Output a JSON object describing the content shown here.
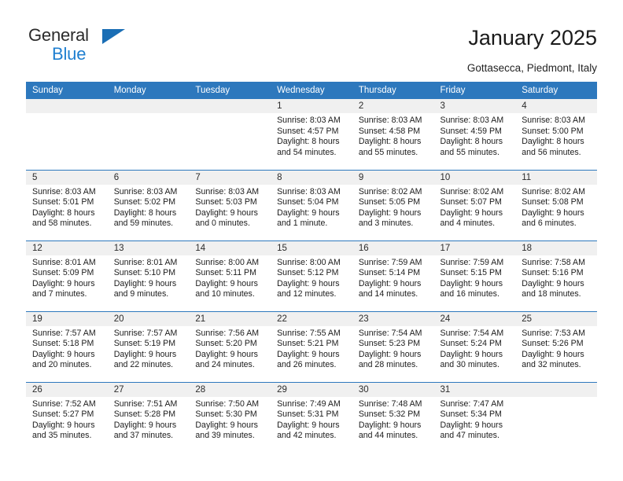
{
  "brand": {
    "line1": "General",
    "line2": "Blue",
    "accent_color": "#1f7fd0",
    "triangle_color": "#1a6eb5"
  },
  "header": {
    "title": "January 2025",
    "subtitle": "Gottasecca, Piedmont, Italy"
  },
  "theme": {
    "header_bg": "#2d78bd",
    "header_text": "#ffffff",
    "daynum_bg": "#f0f0f0",
    "cell_bg": "#ffffff",
    "text": "#1c1c1c"
  },
  "weekdays": [
    "Sunday",
    "Monday",
    "Tuesday",
    "Wednesday",
    "Thursday",
    "Friday",
    "Saturday"
  ],
  "labels": {
    "sunrise": "Sunrise:",
    "sunset": "Sunset:",
    "daylight": "Daylight:"
  },
  "weeks": [
    [
      {
        "day": ""
      },
      {
        "day": ""
      },
      {
        "day": ""
      },
      {
        "day": "1",
        "sunrise": "Sunrise: 8:03 AM",
        "sunset": "Sunset: 4:57 PM",
        "daylight1": "Daylight: 8 hours",
        "daylight2": "and 54 minutes."
      },
      {
        "day": "2",
        "sunrise": "Sunrise: 8:03 AM",
        "sunset": "Sunset: 4:58 PM",
        "daylight1": "Daylight: 8 hours",
        "daylight2": "and 55 minutes."
      },
      {
        "day": "3",
        "sunrise": "Sunrise: 8:03 AM",
        "sunset": "Sunset: 4:59 PM",
        "daylight1": "Daylight: 8 hours",
        "daylight2": "and 55 minutes."
      },
      {
        "day": "4",
        "sunrise": "Sunrise: 8:03 AM",
        "sunset": "Sunset: 5:00 PM",
        "daylight1": "Daylight: 8 hours",
        "daylight2": "and 56 minutes."
      }
    ],
    [
      {
        "day": "5",
        "sunrise": "Sunrise: 8:03 AM",
        "sunset": "Sunset: 5:01 PM",
        "daylight1": "Daylight: 8 hours",
        "daylight2": "and 58 minutes."
      },
      {
        "day": "6",
        "sunrise": "Sunrise: 8:03 AM",
        "sunset": "Sunset: 5:02 PM",
        "daylight1": "Daylight: 8 hours",
        "daylight2": "and 59 minutes."
      },
      {
        "day": "7",
        "sunrise": "Sunrise: 8:03 AM",
        "sunset": "Sunset: 5:03 PM",
        "daylight1": "Daylight: 9 hours",
        "daylight2": "and 0 minutes."
      },
      {
        "day": "8",
        "sunrise": "Sunrise: 8:03 AM",
        "sunset": "Sunset: 5:04 PM",
        "daylight1": "Daylight: 9 hours",
        "daylight2": "and 1 minute."
      },
      {
        "day": "9",
        "sunrise": "Sunrise: 8:02 AM",
        "sunset": "Sunset: 5:05 PM",
        "daylight1": "Daylight: 9 hours",
        "daylight2": "and 3 minutes."
      },
      {
        "day": "10",
        "sunrise": "Sunrise: 8:02 AM",
        "sunset": "Sunset: 5:07 PM",
        "daylight1": "Daylight: 9 hours",
        "daylight2": "and 4 minutes."
      },
      {
        "day": "11",
        "sunrise": "Sunrise: 8:02 AM",
        "sunset": "Sunset: 5:08 PM",
        "daylight1": "Daylight: 9 hours",
        "daylight2": "and 6 minutes."
      }
    ],
    [
      {
        "day": "12",
        "sunrise": "Sunrise: 8:01 AM",
        "sunset": "Sunset: 5:09 PM",
        "daylight1": "Daylight: 9 hours",
        "daylight2": "and 7 minutes."
      },
      {
        "day": "13",
        "sunrise": "Sunrise: 8:01 AM",
        "sunset": "Sunset: 5:10 PM",
        "daylight1": "Daylight: 9 hours",
        "daylight2": "and 9 minutes."
      },
      {
        "day": "14",
        "sunrise": "Sunrise: 8:00 AM",
        "sunset": "Sunset: 5:11 PM",
        "daylight1": "Daylight: 9 hours",
        "daylight2": "and 10 minutes."
      },
      {
        "day": "15",
        "sunrise": "Sunrise: 8:00 AM",
        "sunset": "Sunset: 5:12 PM",
        "daylight1": "Daylight: 9 hours",
        "daylight2": "and 12 minutes."
      },
      {
        "day": "16",
        "sunrise": "Sunrise: 7:59 AM",
        "sunset": "Sunset: 5:14 PM",
        "daylight1": "Daylight: 9 hours",
        "daylight2": "and 14 minutes."
      },
      {
        "day": "17",
        "sunrise": "Sunrise: 7:59 AM",
        "sunset": "Sunset: 5:15 PM",
        "daylight1": "Daylight: 9 hours",
        "daylight2": "and 16 minutes."
      },
      {
        "day": "18",
        "sunrise": "Sunrise: 7:58 AM",
        "sunset": "Sunset: 5:16 PM",
        "daylight1": "Daylight: 9 hours",
        "daylight2": "and 18 minutes."
      }
    ],
    [
      {
        "day": "19",
        "sunrise": "Sunrise: 7:57 AM",
        "sunset": "Sunset: 5:18 PM",
        "daylight1": "Daylight: 9 hours",
        "daylight2": "and 20 minutes."
      },
      {
        "day": "20",
        "sunrise": "Sunrise: 7:57 AM",
        "sunset": "Sunset: 5:19 PM",
        "daylight1": "Daylight: 9 hours",
        "daylight2": "and 22 minutes."
      },
      {
        "day": "21",
        "sunrise": "Sunrise: 7:56 AM",
        "sunset": "Sunset: 5:20 PM",
        "daylight1": "Daylight: 9 hours",
        "daylight2": "and 24 minutes."
      },
      {
        "day": "22",
        "sunrise": "Sunrise: 7:55 AM",
        "sunset": "Sunset: 5:21 PM",
        "daylight1": "Daylight: 9 hours",
        "daylight2": "and 26 minutes."
      },
      {
        "day": "23",
        "sunrise": "Sunrise: 7:54 AM",
        "sunset": "Sunset: 5:23 PM",
        "daylight1": "Daylight: 9 hours",
        "daylight2": "and 28 minutes."
      },
      {
        "day": "24",
        "sunrise": "Sunrise: 7:54 AM",
        "sunset": "Sunset: 5:24 PM",
        "daylight1": "Daylight: 9 hours",
        "daylight2": "and 30 minutes."
      },
      {
        "day": "25",
        "sunrise": "Sunrise: 7:53 AM",
        "sunset": "Sunset: 5:26 PM",
        "daylight1": "Daylight: 9 hours",
        "daylight2": "and 32 minutes."
      }
    ],
    [
      {
        "day": "26",
        "sunrise": "Sunrise: 7:52 AM",
        "sunset": "Sunset: 5:27 PM",
        "daylight1": "Daylight: 9 hours",
        "daylight2": "and 35 minutes."
      },
      {
        "day": "27",
        "sunrise": "Sunrise: 7:51 AM",
        "sunset": "Sunset: 5:28 PM",
        "daylight1": "Daylight: 9 hours",
        "daylight2": "and 37 minutes."
      },
      {
        "day": "28",
        "sunrise": "Sunrise: 7:50 AM",
        "sunset": "Sunset: 5:30 PM",
        "daylight1": "Daylight: 9 hours",
        "daylight2": "and 39 minutes."
      },
      {
        "day": "29",
        "sunrise": "Sunrise: 7:49 AM",
        "sunset": "Sunset: 5:31 PM",
        "daylight1": "Daylight: 9 hours",
        "daylight2": "and 42 minutes."
      },
      {
        "day": "30",
        "sunrise": "Sunrise: 7:48 AM",
        "sunset": "Sunset: 5:32 PM",
        "daylight1": "Daylight: 9 hours",
        "daylight2": "and 44 minutes."
      },
      {
        "day": "31",
        "sunrise": "Sunrise: 7:47 AM",
        "sunset": "Sunset: 5:34 PM",
        "daylight1": "Daylight: 9 hours",
        "daylight2": "and 47 minutes."
      },
      {
        "day": ""
      }
    ]
  ]
}
